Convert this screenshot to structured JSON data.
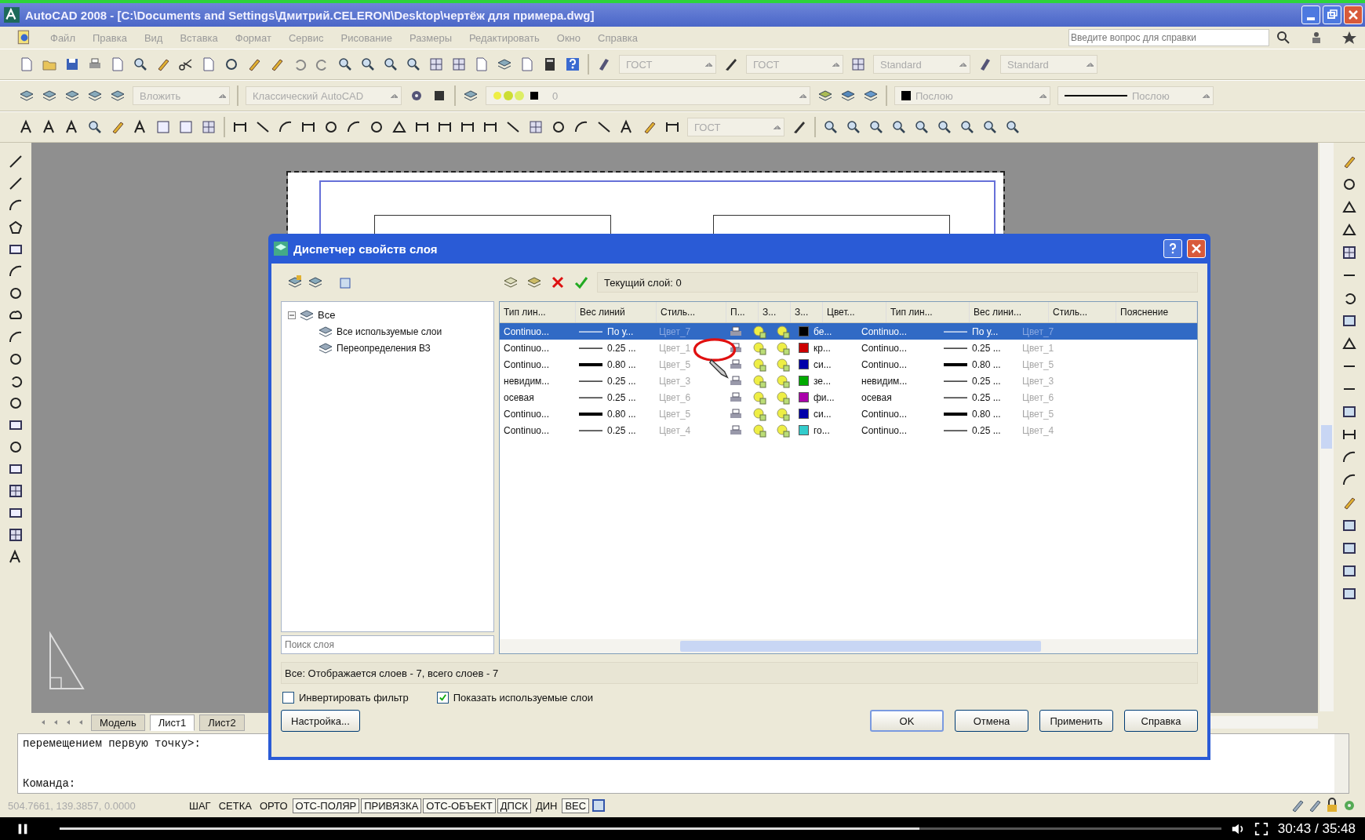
{
  "window": {
    "title": "AutoCAD 2008 - [C:\\Documents and Settings\\Дмитрий.CELERON\\Desktop\\чертёж для примера.dwg]"
  },
  "menu": [
    "Файл",
    "Правка",
    "Вид",
    "Вставка",
    "Формат",
    "Сервис",
    "Рисование",
    "Размеры",
    "Редактировать",
    "Окно",
    "Справка"
  ],
  "help_search": {
    "placeholder": "Введите вопрос для справки"
  },
  "toolbars": {
    "text_style": "ГОСТ",
    "dim_style": "ГОСТ",
    "table_style": "Standard",
    "mleader_style": "Standard",
    "layer_state": "Вложить",
    "workspace": "Классический AutoCAD",
    "layer": "0",
    "color_text": "Послою",
    "linetype": "Послою",
    "dim_style_2": "ГОСТ"
  },
  "layout_tabs": [
    {
      "label": "Модель",
      "selected": false
    },
    {
      "label": "Лист1",
      "selected": true
    },
    {
      "label": "Лист2",
      "selected": false
    }
  ],
  "command_line": [
    "перемещением первую точку>:",
    "Команда:"
  ],
  "status_bar": {
    "coordinates": "504.7661, 139.3857, 0.0000",
    "toggles": [
      {
        "label": "ШАГ",
        "on": false
      },
      {
        "label": "СЕТКА",
        "on": false
      },
      {
        "label": "ОРТО",
        "on": false
      },
      {
        "label": "ОТС-ПОЛЯР",
        "on": true
      },
      {
        "label": "ПРИВЯЗКА",
        "on": true
      },
      {
        "label": "ОТС-ОБЪЕКТ",
        "on": true
      },
      {
        "label": "ДПСК",
        "on": true
      },
      {
        "label": "ДИН",
        "on": false
      },
      {
        "label": "ВЕС",
        "on": true
      }
    ]
  },
  "dialog": {
    "title": "Диспетчер свойств слоя",
    "current_layer": "Текущий слой: 0",
    "tree": [
      {
        "label": "Все",
        "expanded": true,
        "children": [
          {
            "label": "Все используемые слои"
          },
          {
            "label": "Переопределения ВЗ"
          }
        ]
      }
    ],
    "search": {
      "placeholder": "Поиск слоя"
    },
    "columns": [
      "Тип лин...",
      "Вес линий",
      "Стиль...",
      "П...",
      "З...",
      "З...",
      "Цвет...",
      "Тип лин...",
      "Вес лини...",
      "Стиль...",
      "Пояснение"
    ],
    "rows": [
      {
        "selected": true,
        "linetype": "Continuo...",
        "lineweight": "По у...",
        "thick": false,
        "plot_style": "Цвет_7",
        "color": "#000000",
        "color_name": "бе...",
        "vp_linetype": "Continuo...",
        "vp_lineweight": "По у...",
        "vp_plot_style": "Цвет_7"
      },
      {
        "selected": false,
        "linetype": "Continuo...",
        "lineweight": "0.25 ...",
        "thick": false,
        "plot_style": "Цвет_1",
        "color": "#cc0000",
        "color_name": "кр...",
        "vp_linetype": "Continuo...",
        "vp_lineweight": "0.25 ...",
        "vp_plot_style": "Цвет_1"
      },
      {
        "selected": false,
        "linetype": "Continuo...",
        "lineweight": "0.80 ...",
        "thick": true,
        "plot_style": "Цвет_5",
        "color": "#0000aa",
        "color_name": "си...",
        "vp_linetype": "Continuo...",
        "vp_lineweight": "0.80 ...",
        "vp_plot_style": "Цвет_5"
      },
      {
        "selected": false,
        "linetype": "невидим...",
        "lineweight": "0.25 ...",
        "thick": false,
        "plot_style": "Цвет_3",
        "color": "#00aa00",
        "color_name": "зе...",
        "vp_linetype": "невидим...",
        "vp_lineweight": "0.25 ...",
        "vp_plot_style": "Цвет_3"
      },
      {
        "selected": false,
        "linetype": "осевая",
        "lineweight": "0.25 ...",
        "thick": false,
        "plot_style": "Цвет_6",
        "color": "#aa00aa",
        "color_name": "фи...",
        "vp_linetype": "осевая",
        "vp_lineweight": "0.25 ...",
        "vp_plot_style": "Цвет_6"
      },
      {
        "selected": false,
        "linetype": "Continuo...",
        "lineweight": "0.80 ...",
        "thick": true,
        "plot_style": "Цвет_5",
        "color": "#0000aa",
        "color_name": "си...",
        "vp_linetype": "Continuo...",
        "vp_lineweight": "0.80 ...",
        "vp_plot_style": "Цвет_5"
      },
      {
        "selected": false,
        "linetype": "Continuo...",
        "lineweight": "0.25 ...",
        "thick": false,
        "plot_style": "Цвет_4",
        "color": "#33cccc",
        "color_name": "го...",
        "vp_linetype": "Continuo...",
        "vp_lineweight": "0.25 ...",
        "vp_plot_style": "Цвет_4"
      }
    ],
    "summary": "Все: Отображается слоев - 7, всего слоев - 7",
    "options": [
      {
        "label": "Инвертировать фильтр",
        "checked": false
      },
      {
        "label": "Показать используемые слои",
        "checked": true
      }
    ],
    "settings_button": "Настройка...",
    "buttons": [
      "OK",
      "Отмена",
      "Применить",
      "Справка"
    ]
  },
  "player": {
    "time": "30:43 / 35:48",
    "level": 0.74
  }
}
